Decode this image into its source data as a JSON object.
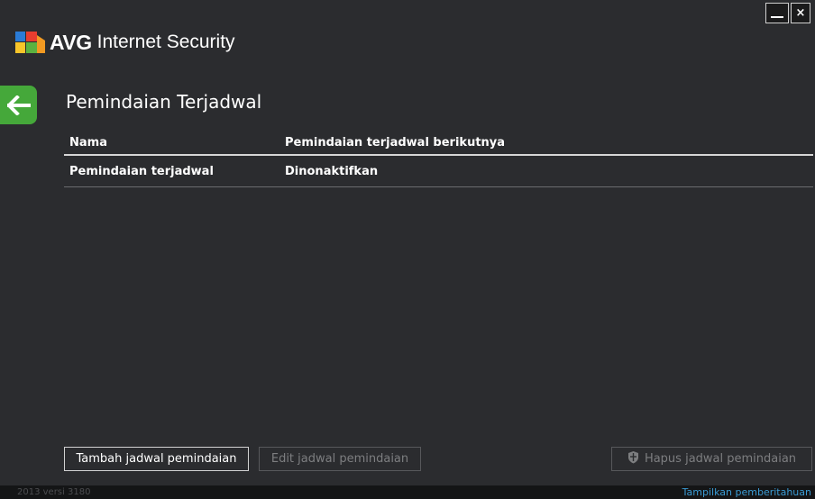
{
  "window": {
    "minimize_label": "_",
    "close_label": "×"
  },
  "brand": {
    "name": "AVG",
    "product": "Internet Security"
  },
  "page": {
    "title": "Pemindaian Terjadwal"
  },
  "table": {
    "columns": [
      "Nama",
      "Pemindaian terjadwal berikutnya"
    ],
    "rows": [
      [
        "Pemindaian terjadwal",
        "Dinonaktifkan"
      ]
    ]
  },
  "buttons": {
    "add": "Tambah jadwal pemindaian",
    "edit": "Edit jadwal pemindaian",
    "delete": "Hapus jadwal pemindaian"
  },
  "footer": {
    "version": "2013  versi 3180",
    "notifications_link": "Tampilkan pemberitahuan"
  },
  "colors": {
    "background": "#2b2c2f",
    "accent_green": "#45a83a",
    "link_blue": "#3a9bd4"
  },
  "icons": {
    "back": "arrow-left-icon",
    "delete": "shield-icon",
    "logo": "avg-logo"
  }
}
